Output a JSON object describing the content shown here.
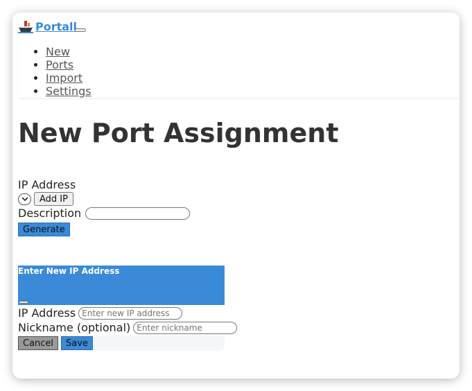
{
  "navbar": {
    "brand": "Portall",
    "links": [
      "New",
      "Ports",
      "Import",
      "Settings"
    ]
  },
  "page": {
    "title": "New Port Assignment"
  },
  "form": {
    "ip_label": "IP Address",
    "add_ip_button": "Add IP",
    "description_label": "Description",
    "generate_button": "Generate"
  },
  "modal": {
    "title": "Enter New IP Address",
    "ip_label": "IP Address",
    "ip_placeholder": "Enter new IP address",
    "nickname_label": "Nickname (optional)",
    "nickname_placeholder": "Enter nickname",
    "cancel_button": "Cancel",
    "save_button": "Save"
  },
  "colors": {
    "accent": "#3a8ad8",
    "cancel_gray": "#999999"
  }
}
